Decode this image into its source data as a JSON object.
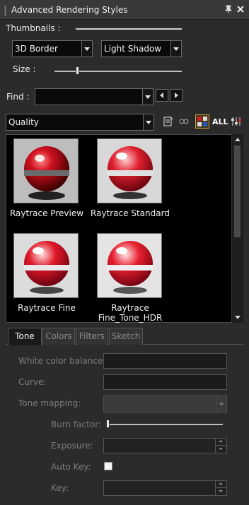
{
  "panel": {
    "title": "Advanced Rendering Styles"
  },
  "thumbnails_label": "Thumbnails :",
  "size_label": "Size :",
  "size_slider_fraction": 0.18,
  "border_select": "3D Border",
  "shadow_select": "Light Shadow",
  "find_label": "Find :",
  "find_value": "",
  "category_select": "Quality",
  "toolbar_icon_label": "ALL",
  "styles": [
    {
      "name": "Raytrace Preview",
      "line2": ""
    },
    {
      "name": "Raytrace Standard",
      "line2": ""
    },
    {
      "name": "Raytrace Fine",
      "line2": ""
    },
    {
      "name": "Raytrace",
      "line2": "Fine_Tone_HDR"
    }
  ],
  "tabs": [
    "Tone",
    "Colors",
    "Filters",
    "Sketch"
  ],
  "active_tab": "Tone",
  "tone": {
    "white_balance_label": "White color balance:",
    "curve_label": "Curve:",
    "tone_mapping_label": "Tone mapping:",
    "burn_factor_label": "Burn factor:",
    "burn_factor_fraction": 0.0,
    "exposure_label": "Exposure:",
    "auto_key_label": "Auto Key:",
    "key_label": "Key:"
  },
  "colors": {
    "accent": "#c8a040",
    "sphere_red": "#d01020",
    "panel_bg": "#2b2b2b"
  }
}
